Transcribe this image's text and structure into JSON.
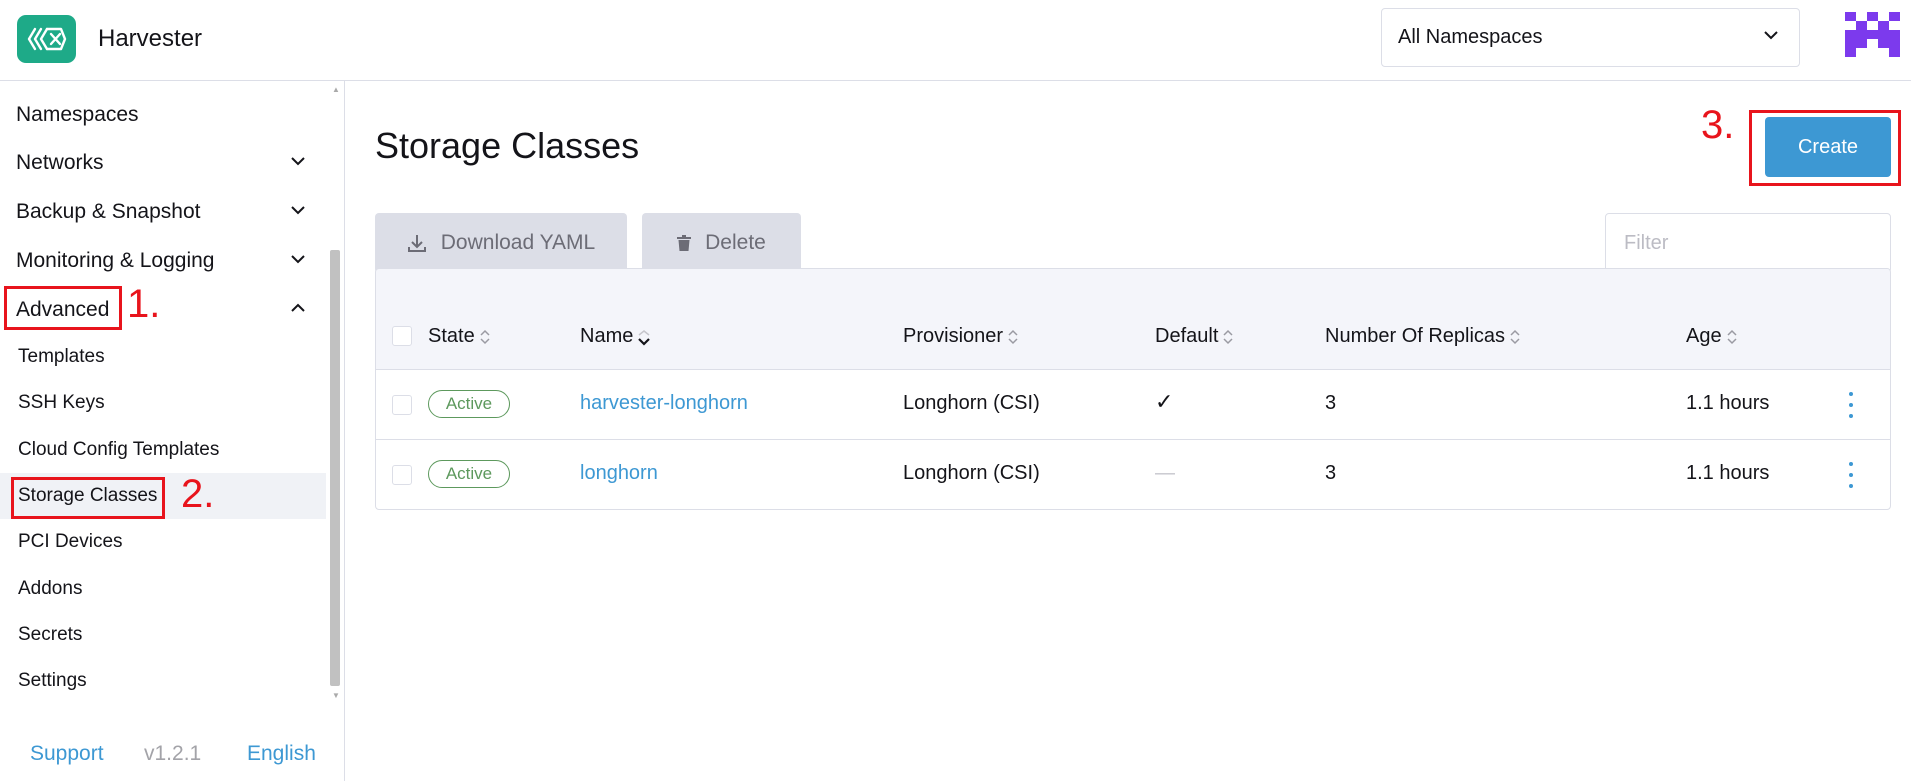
{
  "header": {
    "app_title": "Harvester",
    "namespace_select": "All Namespaces"
  },
  "sidebar": {
    "items": [
      {
        "label": "Namespaces"
      },
      {
        "label": "Networks"
      },
      {
        "label": "Backup & Snapshot"
      },
      {
        "label": "Monitoring & Logging"
      },
      {
        "label": "Advanced"
      }
    ],
    "advanced_children": [
      {
        "label": "Templates"
      },
      {
        "label": "SSH Keys"
      },
      {
        "label": "Cloud Config Templates"
      },
      {
        "label": "Storage Classes"
      },
      {
        "label": "PCI Devices"
      },
      {
        "label": "Addons"
      },
      {
        "label": "Secrets"
      },
      {
        "label": "Settings"
      }
    ],
    "footer": {
      "support": "Support",
      "version": "v1.2.1",
      "language": "English"
    }
  },
  "main": {
    "title": "Storage Classes",
    "create_label": "Create",
    "download_yaml_label": "Download YAML",
    "delete_label": "Delete",
    "filter_placeholder": "Filter"
  },
  "table": {
    "columns": [
      "State",
      "Name",
      "Provisioner",
      "Default",
      "Number Of Replicas",
      "Age"
    ],
    "rows": [
      {
        "state": "Active",
        "name": "harvester-longhorn",
        "provisioner": "Longhorn (CSI)",
        "default": "✓",
        "replicas": "3",
        "age": "1.1 hours"
      },
      {
        "state": "Active",
        "name": "longhorn",
        "provisioner": "Longhorn (CSI)",
        "default": "—",
        "replicas": "3",
        "age": "1.1 hours"
      }
    ]
  },
  "annotations": [
    "1.",
    "2.",
    "3."
  ],
  "colors": {
    "primary": "#3d98d3",
    "logo": "#1eaa88",
    "avatar": "#7c3aed",
    "annotation": "#e8141c",
    "active": "#5d995d"
  }
}
